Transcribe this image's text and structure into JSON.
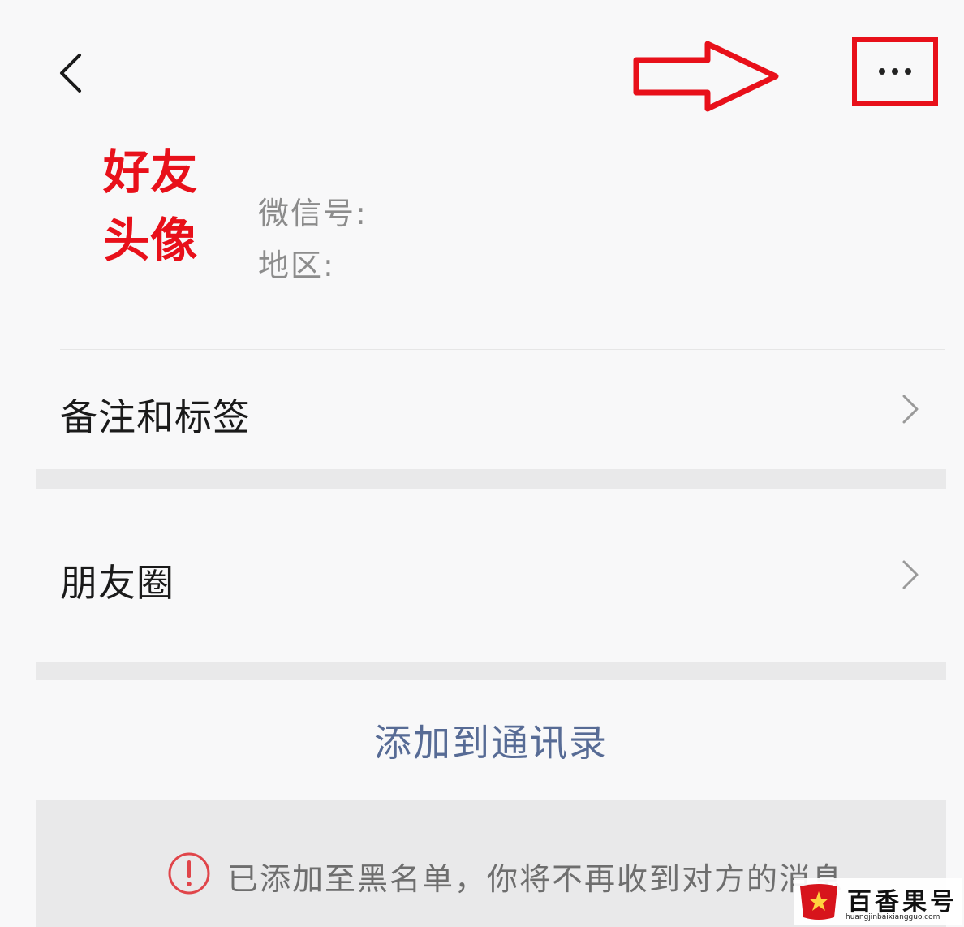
{
  "profile": {
    "avatar_placeholder_line1": "好友",
    "avatar_placeholder_line2": "头像",
    "wechat_id_label": "微信号:",
    "region_label": "地区:"
  },
  "menu": {
    "remark_tags": "备注和标签",
    "moments": "朋友圈"
  },
  "actions": {
    "add_to_contacts": "添加到通讯录"
  },
  "notice": {
    "blacklist_message": "已添加至黑名单，你将不再收到对方的消息"
  },
  "watermark": {
    "brand": "百香果号",
    "url": "huangjinbaixiangguo.com"
  },
  "colors": {
    "annotation_red": "#e8101a",
    "link_blue": "#576b95",
    "notice_red": "#e0454a"
  },
  "icons": {
    "back": "back-chevron-icon",
    "more": "more-dots-icon",
    "chevron": "chevron-right-icon",
    "alert": "exclamation-circle-icon",
    "arrow": "annotation-arrow-icon"
  }
}
